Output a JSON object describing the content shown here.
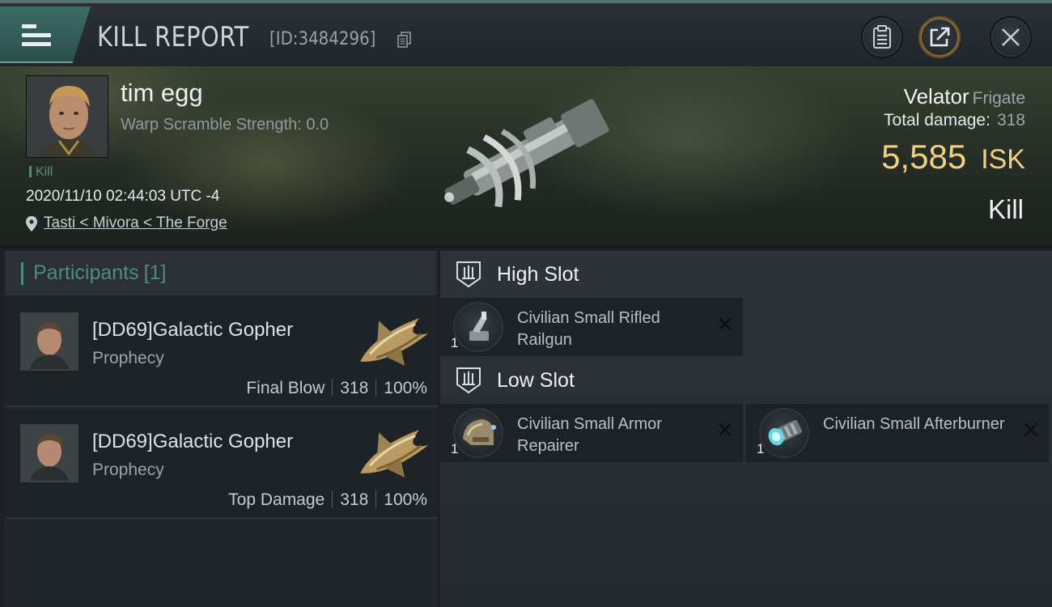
{
  "header": {
    "title": "KILL REPORT",
    "report_id": "[ID:3484296]",
    "icons": [
      "menu-icon",
      "copy-icon",
      "clipboard-icon",
      "share-icon",
      "close-icon"
    ]
  },
  "victim": {
    "name": "tim egg",
    "warp_scramble": "Warp Scramble Strength: 0.0",
    "tag": "Kill",
    "date": "2020/11/10 02:44:03 UTC -4",
    "location": "Tasti < Mivora < The Forge",
    "ship_name": "Velator",
    "ship_class": "Frigate",
    "damage_label": "Total damage:",
    "damage_value": "318",
    "isk_value": "5,585",
    "isk_unit": "ISK",
    "status": "Kill"
  },
  "participants": {
    "title": "Participants",
    "count": "[1]",
    "rows": [
      {
        "name": "[DD69]Galactic Gopher",
        "ship": "Prophecy",
        "role": "Final Blow",
        "damage": "318",
        "percent": "100%"
      },
      {
        "name": "[DD69]Galactic Gopher",
        "ship": "Prophecy",
        "role": "Top Damage",
        "damage": "318",
        "percent": "100%"
      }
    ]
  },
  "fitting": {
    "high_slot": {
      "title": "High Slot",
      "items": [
        {
          "name": "Civilian Small Rifled Railgun",
          "qty": "1"
        }
      ]
    },
    "low_slot": {
      "title": "Low Slot",
      "items": [
        {
          "name": "Civilian Small Armor Repairer",
          "qty": "1"
        },
        {
          "name": "Civilian Small Afterburner",
          "qty": "1"
        }
      ]
    }
  },
  "colors": {
    "accent": "#4f8a83",
    "isk_gold": "#f0cf82",
    "panel_bg": "#22272c"
  }
}
